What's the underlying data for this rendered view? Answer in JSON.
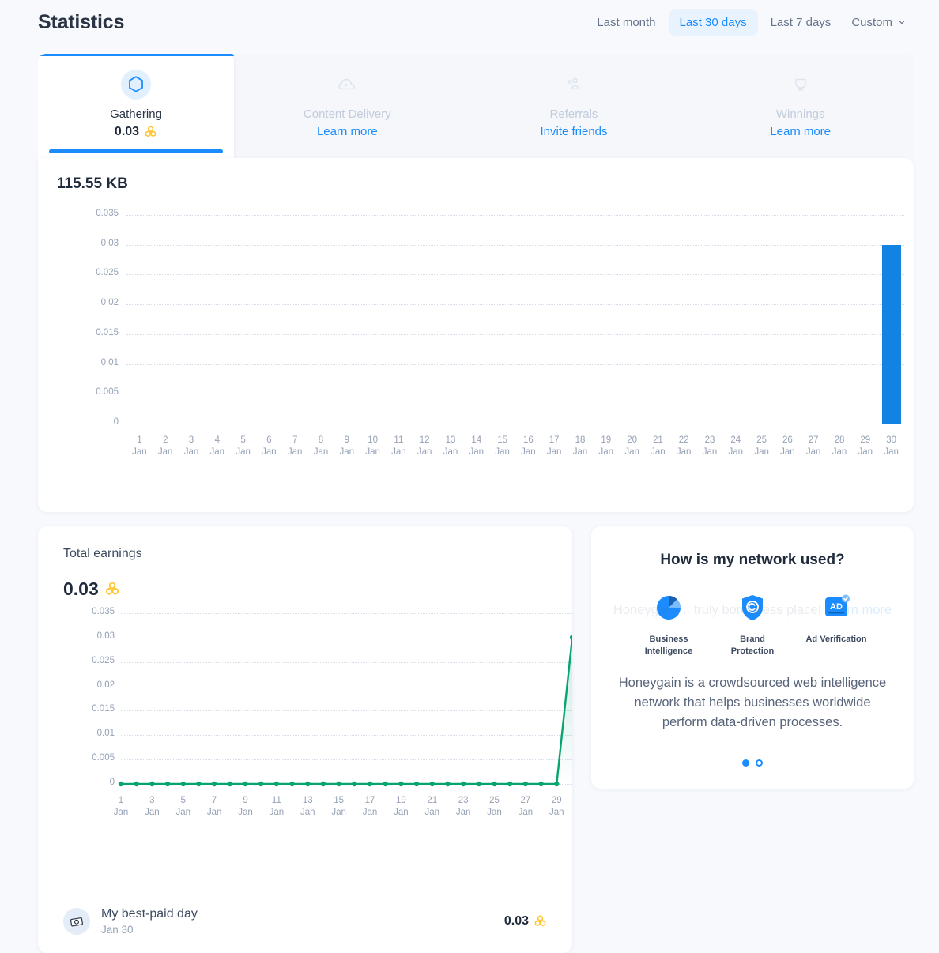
{
  "header": {
    "title": "Statistics",
    "ranges": [
      {
        "label": "Last month",
        "active": false
      },
      {
        "label": "Last 30 days",
        "active": true
      },
      {
        "label": "Last 7 days",
        "active": false
      }
    ],
    "custom_label": "Custom"
  },
  "tabs": [
    {
      "label": "Gathering",
      "icon": "hexagon-icon",
      "value": "0.03",
      "sub": "",
      "active": true
    },
    {
      "label": "Content Delivery",
      "icon": "cloud-play-icon",
      "value": "",
      "sub": "Learn more",
      "active": false
    },
    {
      "label": "Referrals",
      "icon": "people-icon",
      "value": "",
      "sub": "Invite friends",
      "active": false
    },
    {
      "label": "Winnings",
      "icon": "trophy-icon",
      "value": "",
      "sub": "Learn more",
      "active": false
    }
  ],
  "traffic": {
    "total": "115.55 KB"
  },
  "earnings": {
    "title": "Total earnings",
    "value": "0.03",
    "best_day": {
      "title": "My best-paid day",
      "date": "Jan 30",
      "value": "0.03",
      "icon": "money-icon"
    }
  },
  "network_card": {
    "title": "How is my network used?",
    "items": [
      {
        "label": "Business Intelligence",
        "icon": "pie-chart-icon"
      },
      {
        "label": "Brand Protection",
        "icon": "shield-copyright-icon"
      },
      {
        "label": "Ad Verification",
        "icon": "ad-check-icon"
      }
    ],
    "description": "Honeygain is a crowdsourced web intelligence network that helps businesses worldwide perform data-driven processes.",
    "ghost_text": "Honeygain ... truly borderless place!",
    "ghost_link": "Learn more",
    "dots": 2,
    "active_dot": 0
  },
  "colors": {
    "accent_blue": "#1a8cff",
    "bar_blue": "#1283e2",
    "line_green": "#07a370",
    "honey_yellow": "#ffc42e",
    "page_bg": "#f7f9fc"
  },
  "chart_data": [
    {
      "type": "bar",
      "title": "115.55 KB",
      "xlabel": "",
      "ylabel": "",
      "ylim": [
        0,
        0.035
      ],
      "yticks": [
        "0",
        "0.005",
        "0.01",
        "0.015",
        "0.02",
        "0.025",
        "0.03",
        "0.035"
      ],
      "grid": true,
      "legend": "none",
      "categories": [
        "1 Jan",
        "2 Jan",
        "3 Jan",
        "4 Jan",
        "5 Jan",
        "6 Jan",
        "7 Jan",
        "8 Jan",
        "9 Jan",
        "10 Jan",
        "11 Jan",
        "12 Jan",
        "13 Jan",
        "14 Jan",
        "15 Jan",
        "16 Jan",
        "17 Jan",
        "18 Jan",
        "19 Jan",
        "20 Jan",
        "21 Jan",
        "22 Jan",
        "23 Jan",
        "24 Jan",
        "25 Jan",
        "26 Jan",
        "27 Jan",
        "28 Jan",
        "29 Jan",
        "30 Jan"
      ],
      "values": [
        0,
        0,
        0,
        0,
        0,
        0,
        0,
        0,
        0,
        0,
        0,
        0,
        0,
        0,
        0,
        0,
        0,
        0,
        0,
        0,
        0,
        0,
        0,
        0,
        0,
        0,
        0,
        0,
        0,
        0.03
      ]
    },
    {
      "type": "line",
      "title": "Total earnings",
      "xlabel": "",
      "ylabel": "",
      "ylim": [
        0,
        0.035
      ],
      "yticks": [
        "0",
        "0.005",
        "0.01",
        "0.015",
        "0.02",
        "0.025",
        "0.03",
        "0.035"
      ],
      "grid": true,
      "legend": "none",
      "categories": [
        "1 Jan",
        "2 Jan",
        "3 Jan",
        "4 Jan",
        "5 Jan",
        "6 Jan",
        "7 Jan",
        "8 Jan",
        "9 Jan",
        "10 Jan",
        "11 Jan",
        "12 Jan",
        "13 Jan",
        "14 Jan",
        "15 Jan",
        "16 Jan",
        "17 Jan",
        "18 Jan",
        "19 Jan",
        "20 Jan",
        "21 Jan",
        "22 Jan",
        "23 Jan",
        "24 Jan",
        "25 Jan",
        "26 Jan",
        "27 Jan",
        "28 Jan",
        "29 Jan",
        "30 Jan"
      ],
      "xtick_labels": [
        "1 Jan",
        "3 Jan",
        "5 Jan",
        "7 Jan",
        "9 Jan",
        "11 Jan",
        "13 Jan",
        "15 Jan",
        "17 Jan",
        "19 Jan",
        "21 Jan",
        "23 Jan",
        "25 Jan",
        "27 Jan",
        "29 Jan"
      ],
      "values": [
        0,
        0,
        0,
        0,
        0,
        0,
        0,
        0,
        0,
        0,
        0,
        0,
        0,
        0,
        0,
        0,
        0,
        0,
        0,
        0,
        0,
        0,
        0,
        0,
        0,
        0,
        0,
        0,
        0,
        0.03
      ]
    }
  ]
}
